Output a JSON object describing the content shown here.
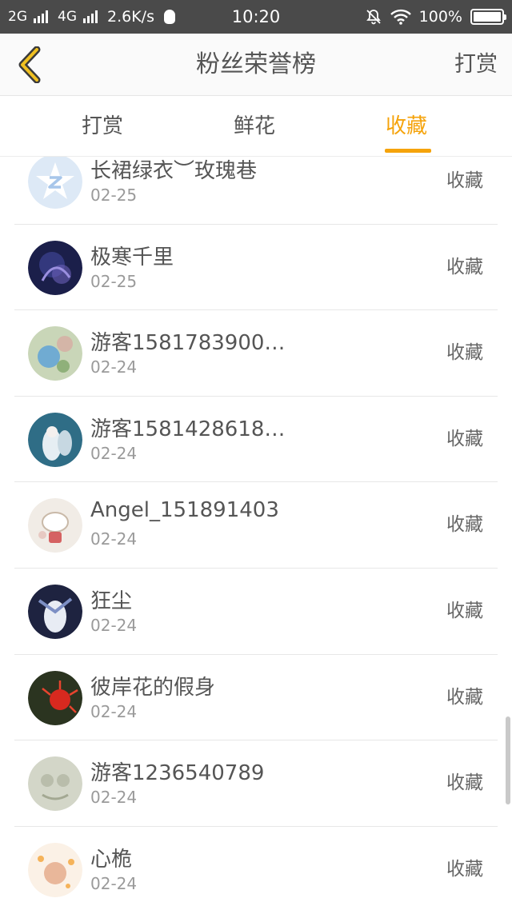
{
  "status_bar": {
    "network1": "2G",
    "network2": "4G",
    "speed": "2.6K/s",
    "time": "10:20",
    "battery": "100%",
    "battery_level": 1.0,
    "icons": [
      "signal-icon",
      "qq-icon",
      "mute-bell-icon",
      "wifi-icon",
      "battery-icon"
    ]
  },
  "header": {
    "back_icon": "chevron-left-icon",
    "title": "粉丝荣誉榜",
    "action_label": "打赏"
  },
  "tabs": [
    {
      "label": "打赏",
      "active": false
    },
    {
      "label": "鲜花",
      "active": false
    },
    {
      "label": "收藏",
      "active": true
    }
  ],
  "colors": {
    "accent": "#f5a30b",
    "status_bar_bg": "#4a4a4a"
  },
  "list": [
    {
      "name": "长裙绿衣︶玫瑰巷",
      "date": "02-25",
      "kind": "收藏"
    },
    {
      "name": "极寒千里",
      "date": "02-25",
      "kind": "收藏"
    },
    {
      "name": "游客1581783900…",
      "date": "02-24",
      "kind": "收藏"
    },
    {
      "name": "游客1581428618…",
      "date": "02-24",
      "kind": "收藏"
    },
    {
      "name": "Angel_151891403",
      "date": "02-24",
      "kind": "收藏"
    },
    {
      "name": "狂尘",
      "date": "02-24",
      "kind": "收藏"
    },
    {
      "name": "彼岸花的假身",
      "date": "02-24",
      "kind": "收藏"
    },
    {
      "name": "游客1236540789",
      "date": "02-24",
      "kind": "收藏"
    },
    {
      "name": "心桅",
      "date": "02-24",
      "kind": "收藏"
    }
  ]
}
